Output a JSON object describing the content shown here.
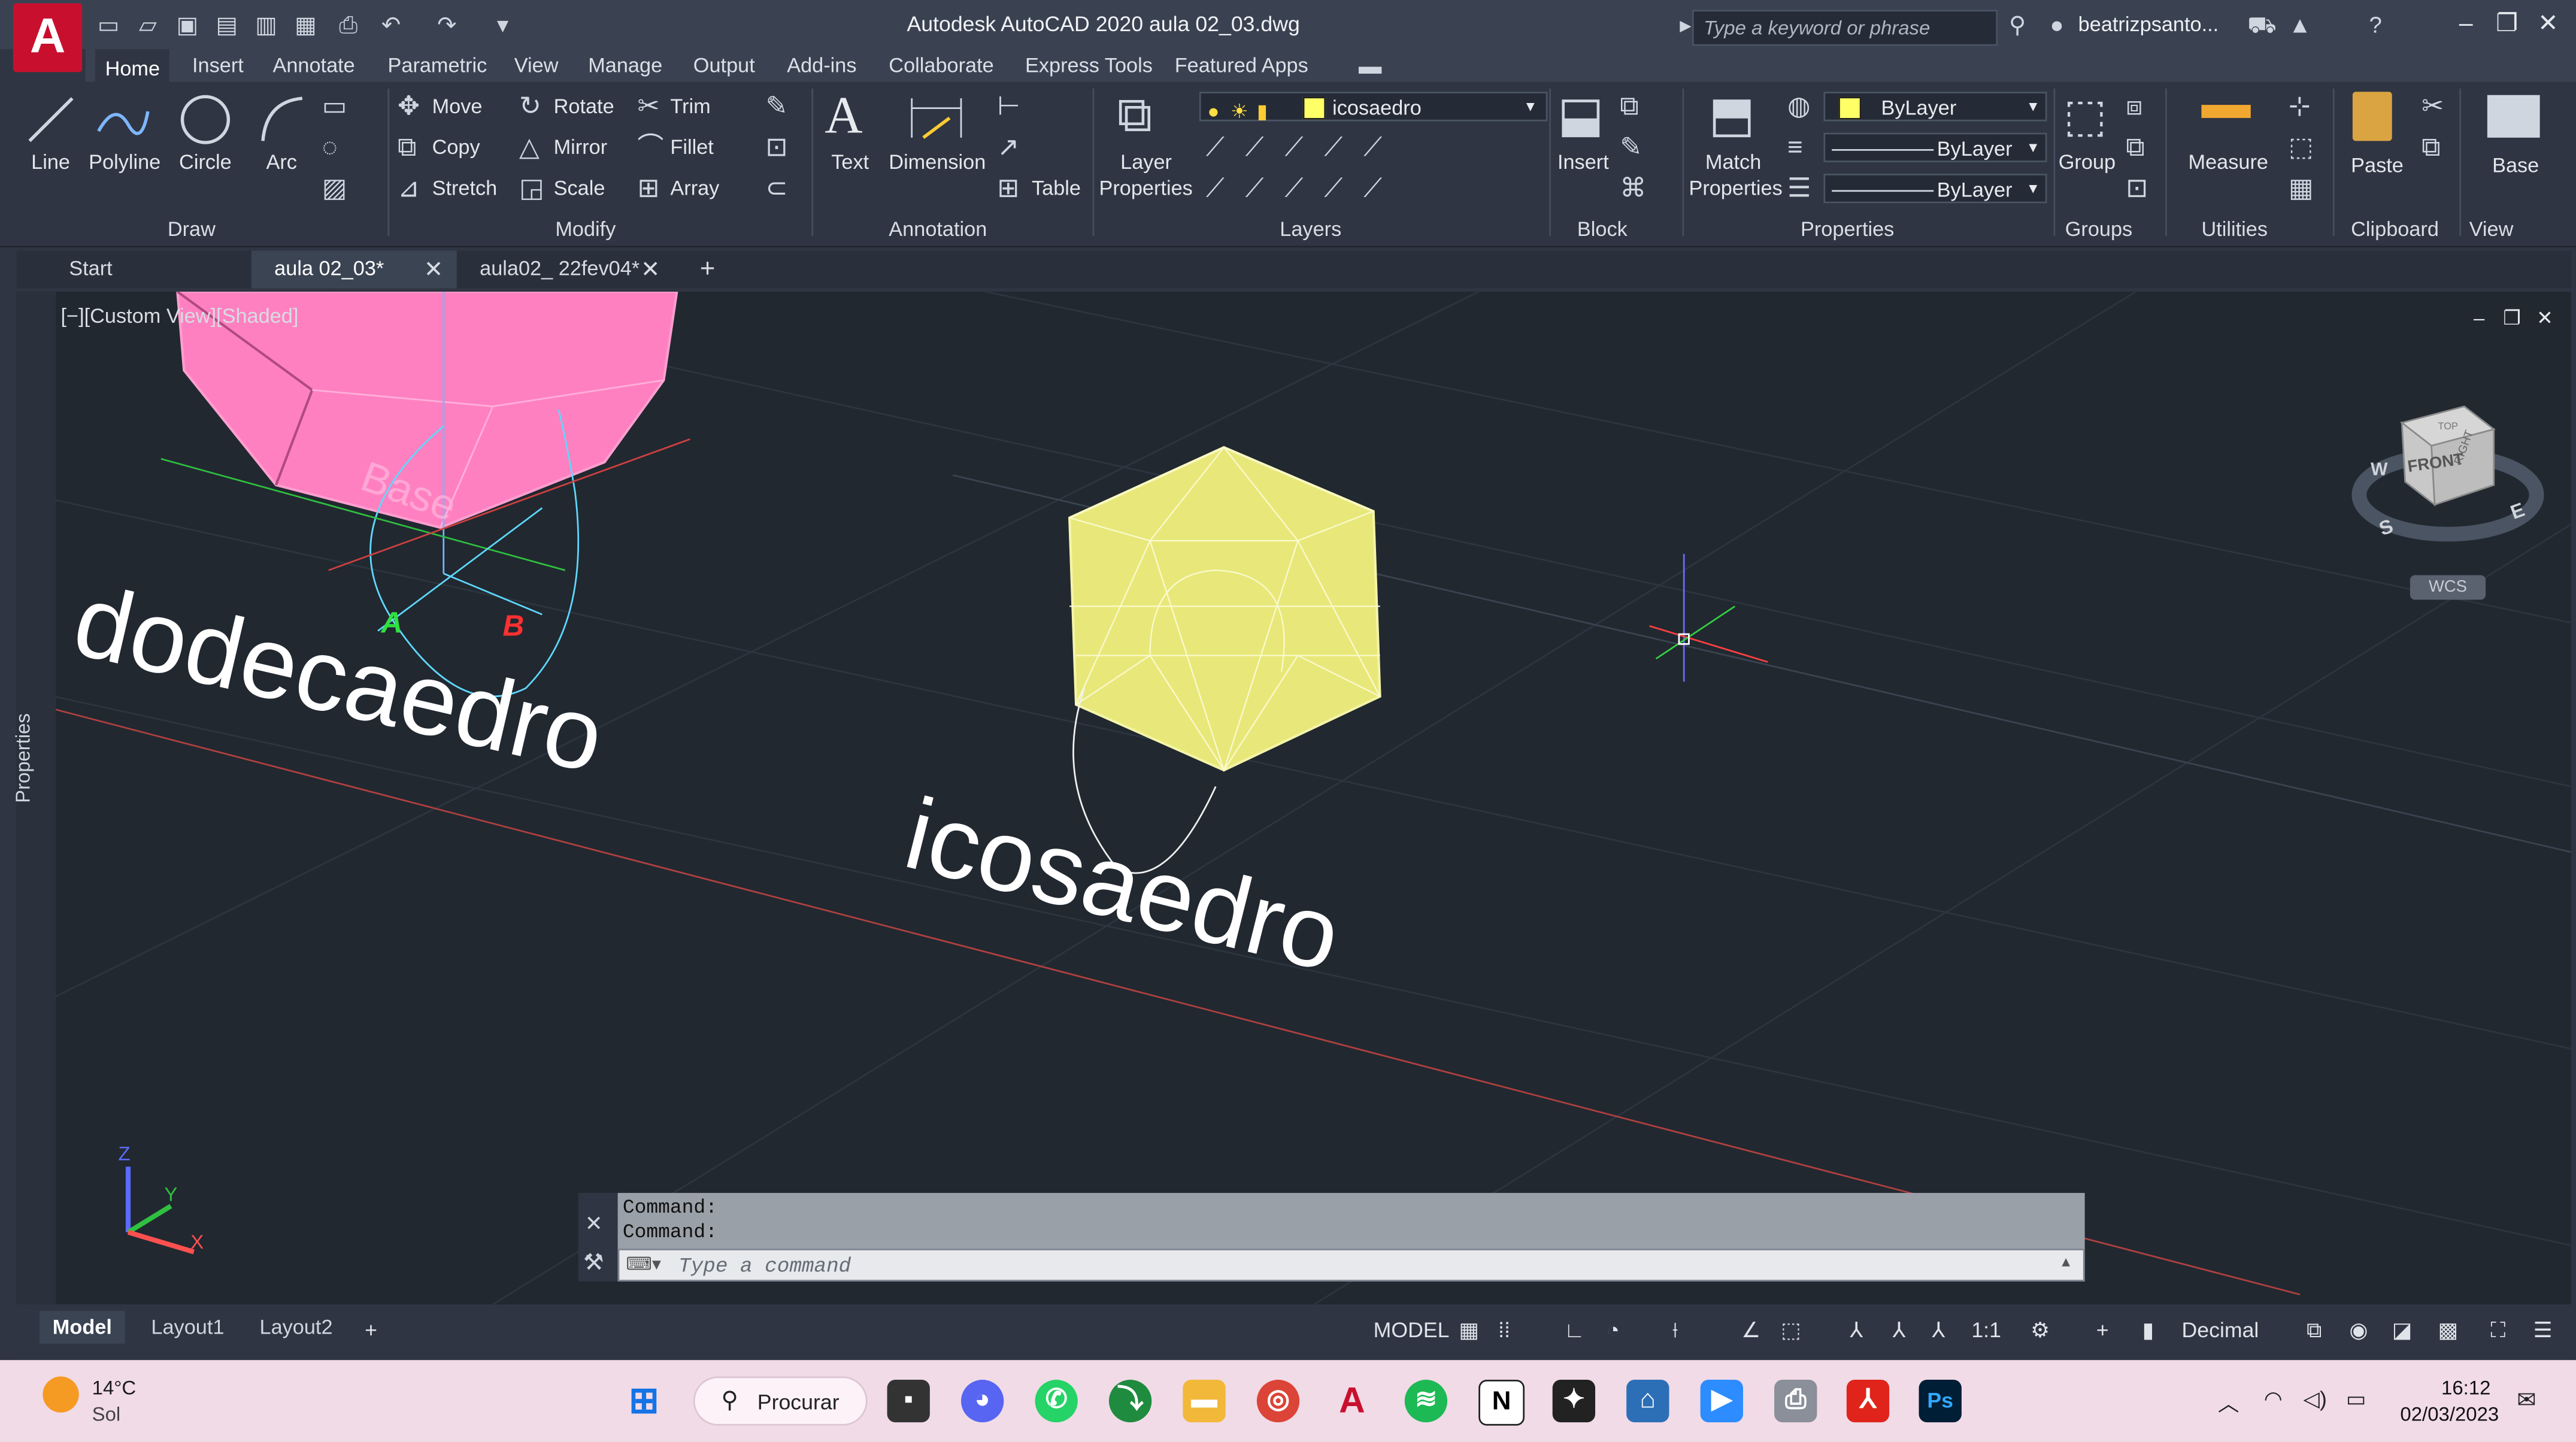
{
  "window": {
    "title": "Autodesk AutoCAD 2020   aula 02_03.dwg",
    "app_logo": "A",
    "search_placeholder": "Type a keyword or phrase",
    "user": "beatrizpsanto..."
  },
  "ribbon_tabs": [
    "Home",
    "Insert",
    "Annotate",
    "Parametric",
    "View",
    "Manage",
    "Output",
    "Add-ins",
    "Collaborate",
    "Express Tools",
    "Featured Apps"
  ],
  "active_tab": "Home",
  "draw": {
    "title": "Draw",
    "line": "Line",
    "polyline": "Polyline",
    "circle": "Circle",
    "arc": "Arc"
  },
  "modify": {
    "title": "Modify",
    "move": "Move",
    "rotate": "Rotate",
    "trim": "Trim",
    "copy": "Copy",
    "mirror": "Mirror",
    "fillet": "Fillet",
    "stretch": "Stretch",
    "scale": "Scale",
    "array": "Array"
  },
  "annotation": {
    "title": "Annotation",
    "text": "Text",
    "dimension": "Dimension",
    "table": "Table"
  },
  "layers": {
    "title": "Layers",
    "layer_properties_1": "Layer",
    "layer_properties_2": "Properties",
    "current_layer": "icosaedro",
    "layer_color": "#ffff66"
  },
  "block": {
    "title": "Block",
    "insert": "Insert"
  },
  "properties": {
    "title": "Properties",
    "match_1": "Match",
    "match_2": "Properties",
    "color": "ByLayer",
    "linetype": "ByLayer",
    "lineweight": "ByLayer"
  },
  "groups": {
    "title": "Groups",
    "group": "Group"
  },
  "utilities": {
    "title": "Utilities",
    "measure": "Measure"
  },
  "clipboard": {
    "title": "Clipboard",
    "paste": "Paste"
  },
  "view_panel": {
    "title": "View",
    "base": "Base"
  },
  "doc_tabs": [
    {
      "label": "Start"
    },
    {
      "label": "aula 02_03*"
    },
    {
      "label": "aula02_ 22fev04*"
    }
  ],
  "viewport": {
    "label": "[−][Custom View][Shaded]",
    "text_dodecaedro": "dodecaedro",
    "text_icosaedro": "icosaedro",
    "text_base": "Base",
    "point_a": "A",
    "point_b": "B",
    "viewcube_front": "FRONT",
    "viewcube_right": "RIGHT",
    "viewcube_top": "TOP",
    "compass_w": "W",
    "compass_s": "S",
    "compass_e": "E",
    "wcs": "WCS",
    "ucs_x": "X",
    "ucs_y": "Y",
    "ucs_z": "Z"
  },
  "side_panel": {
    "label": "Properties"
  },
  "command": {
    "history": [
      "Command:",
      "Command:"
    ],
    "placeholder": "Type a command"
  },
  "layout_tabs": [
    "Model",
    "Layout1",
    "Layout2"
  ],
  "status": {
    "model": "MODEL",
    "scale": "1:1",
    "units": "Decimal"
  },
  "taskbar": {
    "temp": "14°C",
    "weather": "Sol",
    "search": "Procurar",
    "time": "16:12",
    "date": "02/03/2023"
  },
  "colors": {
    "dodeca": "#ff7fbf",
    "icosa": "#e8e87a",
    "accent": "#c8102e"
  }
}
